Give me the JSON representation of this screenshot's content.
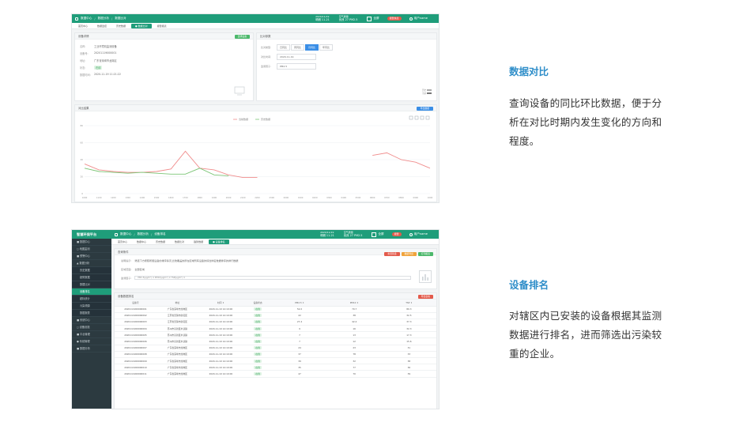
{
  "shot1": {
    "topbar": {
      "crumbs": [
        "数据中心",
        "数据分析",
        "数据比对"
      ],
      "weather1": {
        "line1": "2020/11/19",
        "line2": "晴朗 11-21"
      },
      "weather2": {
        "line1": "空气质量",
        "line2": "优良 27 PM2.5"
      },
      "fullscreen_label": "全屏",
      "alarm_label": "报警信息",
      "user_label": "用户name"
    },
    "tabs": [
      "首页中心",
      "数据监控",
      "历史数据",
      "● 数据比对",
      "报警报表"
    ],
    "device_panel": {
      "title": "设备详情",
      "button": "选择设备",
      "rows": [
        {
          "k": "名称:",
          "v": "工业环境机监测设备"
        },
        {
          "k": "设备号:",
          "v": "20201119000001"
        },
        {
          "k": "地址:",
          "v": "广东省深圳市龙岗区"
        },
        {
          "k": "状态:",
          "v": "在线"
        },
        {
          "k": "数据时间:",
          "v": "2020-11-19 11:21:22"
        }
      ]
    },
    "compare_panel": {
      "title": "比对参数",
      "type_label": "比对类型:",
      "types": [
        "日同比",
        "周同比",
        "月同比",
        "年同比"
      ],
      "time_label": "对比时间:",
      "time_value": "2020-11-19",
      "factor_label": "监测因子:",
      "factor_value": "PM2.5",
      "legend": [
        "历史",
        "当前"
      ]
    },
    "chart_panel": {
      "title": "对比结果",
      "button": "导出数据",
      "legend": [
        "当前数据",
        "历史数据"
      ]
    }
  },
  "chart_data": {
    "type": "line",
    "title": "",
    "x": [
      "1000",
      "1100",
      "1200",
      "1300",
      "1400",
      "1500",
      "1600",
      "1700",
      "1800",
      "1900",
      "2000",
      "2100",
      "2200",
      "2300",
      "0000",
      "0100",
      "0200",
      "0300",
      "0400",
      "0500",
      "0600",
      "0700",
      "0800",
      "0900",
      "1000"
    ],
    "ylim": [
      0,
      80
    ],
    "yticks": [
      "80",
      "60",
      "40",
      "20",
      "0"
    ],
    "grid": true,
    "legend": "top-center",
    "series": [
      {
        "name": "当前数据",
        "color": "#f08c8c",
        "values": [
          35,
          28,
          26,
          25,
          25,
          26,
          29,
          50,
          30,
          28,
          22,
          19,
          19,
          null,
          null,
          null,
          null,
          null,
          null,
          null,
          45,
          48,
          40,
          37,
          30
        ]
      },
      {
        "name": "历史数据",
        "color": "#7cc576",
        "values": [
          30,
          26,
          25,
          24,
          25,
          24,
          23,
          23,
          30,
          22,
          21,
          null,
          null,
          null,
          null,
          null,
          null,
          null,
          null,
          null,
          null,
          null,
          null,
          null,
          null
        ]
      }
    ]
  },
  "shot2": {
    "sidebar": {
      "brand": "智慧环保平台",
      "items": [
        {
          "label": "■ 数据中心",
          "sub": false,
          "active": false
        },
        {
          "label": "◻ 地图监测",
          "sub": false,
          "active": false
        },
        {
          "label": "■ 预警中心",
          "sub": false,
          "active": false
        },
        {
          "label": "▲ 数据分析",
          "sub": false,
          "active": false
        },
        {
          "label": "历史数据",
          "sub": true,
          "active": false
        },
        {
          "label": "趋势数据",
          "sub": true,
          "active": false
        },
        {
          "label": "数据比对",
          "sub": true,
          "active": false
        },
        {
          "label": "设备排名",
          "sub": true,
          "active": true
        },
        {
          "label": "超标统计",
          "sub": true,
          "active": false
        },
        {
          "label": "污染溯源",
          "sub": true,
          "active": false
        },
        {
          "label": "数据报表",
          "sub": true,
          "active": false
        },
        {
          "label": "■ 系统中心",
          "sub": false,
          "active": false
        },
        {
          "label": "◻ 设备设施",
          "sub": false,
          "active": false
        },
        {
          "label": "■ 平台管理",
          "sub": false,
          "active": false
        },
        {
          "label": "● 系统管理",
          "sub": false,
          "active": false
        },
        {
          "label": "■ 数据分析",
          "sub": false,
          "active": false
        }
      ]
    },
    "topbar": {
      "crumbs": [
        "数据中心",
        "数据分析",
        "设备排名"
      ],
      "weather1": {
        "line1": "2020/11/19",
        "line2": "晴朗 11-21"
      },
      "weather2": {
        "line1": "空气质量",
        "line2": "优良 27 PM2.5"
      },
      "fullscreen_label": "全屏",
      "alarm_label": "报警",
      "user_label": "用户name"
    },
    "tabs": [
      "首页中心",
      "数据中心",
      "历史数据",
      "数据比对",
      "趋势数据",
      "● 设备排名"
    ],
    "filter_panel": {
      "title": "查询条件",
      "buttons": [
        "重置筛选",
        "数据导出",
        "打印报表"
      ],
      "note_label": "说明提示:",
      "note": "筛选下方按照所属设备的排序情况,比较覆盖的所在区域所有设备的综合排名数据排序的排行数据",
      "area_label": "区域范围:",
      "area_value": "全部区域",
      "factor_label": "监测因子:",
      "factors": "PM2.5(μg/m³) ✕   PM10(μg/m³) ✕   TSP(μg/m³) ✕"
    },
    "table_panel": {
      "title": "设备数据排名",
      "button": "导出表格",
      "headers": [
        "设备号",
        "地址",
        "时间 ↕",
        "设备状态",
        "PM2.5 ↕",
        "PM10 ↕",
        "TSP ↕"
      ],
      "rows": [
        [
          "2020111900000001",
          "广东省深圳市龙岗区",
          "2020-11-19 14:10:00",
          "在线",
          "52.0",
          "70.7",
          "80.3"
        ],
        [
          "2020111900000002",
          "江苏省无锡市新吴区",
          "2020-11-19 14:10:00",
          "在线",
          "22",
          "38",
          "32.5"
        ],
        [
          "2020111900000003",
          "江苏省无锡市新吴区",
          "2020-11-19 14:10:00",
          "在线",
          "27.4",
          "42.4",
          "37.3"
        ],
        [
          "2020111900000004",
          "苏州市高新区木渎镇",
          "2020-11-19 14:10:00",
          "在线",
          "9",
          "16",
          "32.3"
        ],
        [
          "2020111900000005",
          "苏州市高新区木渎镇",
          "2020-11-19 14:10:00",
          "在线",
          "7",
          "13",
          "17.3"
        ],
        [
          "2020111900000006",
          "苏州市高新区木渎镇",
          "2020-11-19 14:10:00",
          "在线",
          "7",
          "12",
          "15.6"
        ],
        [
          "2020111900000007",
          "广东省深圳市龙岗区",
          "2020-11-19 14:10:00",
          "在线",
          "24",
          "23",
          "31"
        ],
        [
          "2020111900000008",
          "广东省深圳市龙岗区",
          "2020-11-19 14:10:00",
          "在线",
          "37",
          "78",
          "33"
        ],
        [
          "2020111900000009",
          "广东省深圳市龙岗区",
          "2020-11-19 14:10:00",
          "在线",
          "39",
          "32",
          "38"
        ],
        [
          "2020111900000010",
          "广东省深圳市龙岗区",
          "2020-11-19 14:10:00",
          "在线",
          "35",
          "77",
          "36"
        ],
        [
          "2020111900000011",
          "广东省深圳市龙岗区",
          "2020-11-19 14:10:00",
          "在线",
          "47",
          "70",
          "39"
        ]
      ]
    }
  },
  "section1": {
    "title": "数据对比",
    "body": [
      "查询设备的同比环比数据，便于分",
      "析在对比时期内发生变化的方向和",
      "程度。"
    ]
  },
  "section2": {
    "title": "设备排名",
    "body": [
      "对辖区内已安装的设备根据其监测",
      "数据进行排名，进而筛选出污染较",
      "重的企业。"
    ]
  },
  "colors": {
    "brand": "#1f9d7a",
    "accent": "#2f8ec9",
    "current": "#f08c8c",
    "history": "#7cc576"
  }
}
